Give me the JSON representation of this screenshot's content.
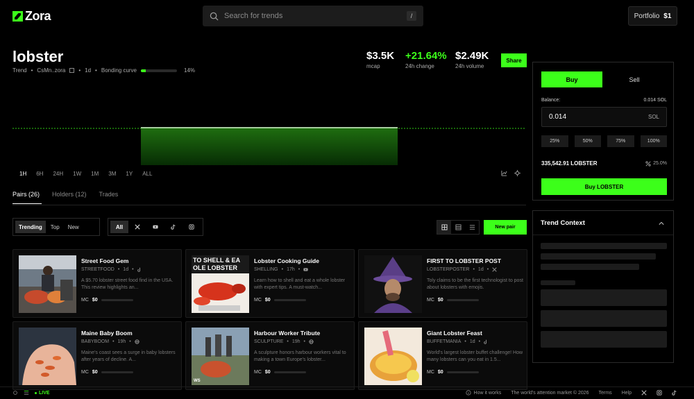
{
  "header": {
    "logo_text": "Zora",
    "search_placeholder": "Search for trends",
    "search_shortcut": "/",
    "portfolio_label": "Portfolio",
    "portfolio_value": "$1"
  },
  "token": {
    "name": "lobster",
    "type": "Trend",
    "address": "CsMn..zora",
    "age": "1d",
    "bonding_label": "Bonding curve",
    "bonding_percent": "14%",
    "bonding_fraction": 0.14
  },
  "stats": {
    "mcap_value": "$3.5K",
    "mcap_label": "mcap",
    "change_value": "+21.64%",
    "change_label": "24h change",
    "volume_value": "$2.49K",
    "volume_label": "24h volume"
  },
  "share_label": "Share",
  "timeframes": [
    "1H",
    "6H",
    "24H",
    "1W",
    "1M",
    "3M",
    "1Y",
    "ALL"
  ],
  "active_timeframe": "1H",
  "tabs": [
    "Pairs (26)",
    "Holders (12)",
    "Trades"
  ],
  "filters": {
    "sort": [
      "Trending",
      "Top",
      "New"
    ],
    "platform_all": "All",
    "new_pair_label": "New pair"
  },
  "cards": [
    {
      "title": "Street Food Gem",
      "ticker": "STREETFOOD",
      "age": "1d",
      "desc": "A $5.70 lobster street food find in the USA. This review highlights an...",
      "mc_label": "MC",
      "mc_value": "$0"
    },
    {
      "title": "Lobster Cooking Guide",
      "ticker": "SHELLING",
      "age": "17h",
      "desc": "Learn how to shell and eat a whole lobster with expert tips. A must-watch...",
      "mc_label": "MC",
      "mc_value": "$0",
      "thumb_text_1": "TO SHELL & EA",
      "thumb_text_2": "OLE LOBSTER"
    },
    {
      "title": "FIRST TO LOBSTER POST",
      "ticker": "LOBSTERPOSTER",
      "age": "1d",
      "desc": "Toly claims to be the first technologist to post about lobsters with emojis.",
      "mc_label": "MC",
      "mc_value": "$0"
    },
    {
      "title": "Maine Baby Boom",
      "ticker": "BABYBOOM",
      "age": "19h",
      "desc": "Maine's coast sees a surge in baby lobsters after years of decline. A...",
      "mc_label": "MC",
      "mc_value": "$0"
    },
    {
      "title": "Harbour Worker Tribute",
      "ticker": "SCULPTURE",
      "age": "19h",
      "desc": "A sculpture honors harbour workers vital to making a town Europe's lobster...",
      "mc_label": "MC",
      "mc_value": "$0",
      "thumb_text_1": "WS"
    },
    {
      "title": "Giant Lobster Feast",
      "ticker": "BUFFETMANIA",
      "age": "1d",
      "desc": "World's largest lobster buffet challenge! How many lobsters can you eat in 1.5...",
      "mc_label": "MC",
      "mc_value": "$0"
    }
  ],
  "trade": {
    "buy_label": "Buy",
    "sell_label": "Sell",
    "balance_label": "Balance:",
    "balance_value": "0.014 SOL",
    "amount_value": "0.014",
    "amount_unit": "SOL",
    "presets": [
      "25%",
      "50%",
      "75%",
      "100%"
    ],
    "receive_value": "335,542.91 LOBSTER",
    "slippage": "25.0%",
    "buy_button": "Buy LOBSTER"
  },
  "context": {
    "title": "Trend Context"
  },
  "footer": {
    "live_label": "LIVE",
    "how_it_works": "How it works",
    "tagline": "The world's attention market © 2026",
    "terms": "Terms",
    "help": "Help"
  },
  "colors": {
    "accent": "#3cff1a",
    "background": "#000000",
    "panel_border": "#2a2a2a"
  }
}
